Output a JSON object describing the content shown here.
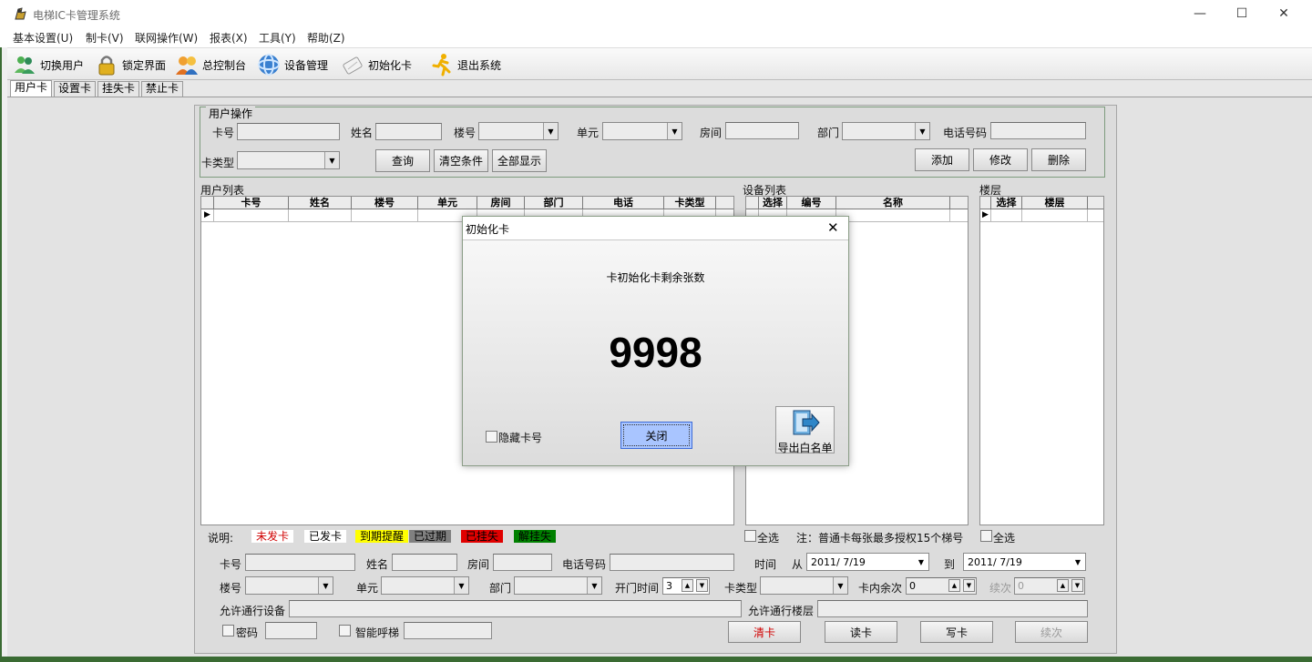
{
  "window": {
    "title": "电梯IC卡管理系统",
    "minimize": "—",
    "maximize": "☐",
    "close": "✕"
  },
  "menu": [
    "基本设置(U)",
    "制卡(V)",
    "联网操作(W)",
    "报表(X)",
    "工具(Y)",
    "帮助(Z)"
  ],
  "toolbar": [
    {
      "label": "切换用户",
      "icon": "users-icon"
    },
    {
      "label": "锁定界面",
      "icon": "lock-icon"
    },
    {
      "label": "总控制台",
      "icon": "console-icon"
    },
    {
      "label": "设备管理",
      "icon": "device-icon"
    },
    {
      "label": "初始化卡",
      "icon": "card-init-icon"
    },
    {
      "label": "退出系统",
      "icon": "exit-runner-icon"
    }
  ],
  "tabs": [
    "用户卡",
    "设置卡",
    "挂失卡",
    "禁止卡"
  ],
  "user_ops": {
    "group_title": "用户操作",
    "card_no": "卡号",
    "name": "姓名",
    "building": "楼号",
    "unit": "单元",
    "room": "房间",
    "dept": "部门",
    "phone": "电话号码",
    "card_type": "卡类型",
    "query": "查询",
    "clear": "清空条件",
    "show_all": "全部显示",
    "add": "添加",
    "modify": "修改",
    "delete": "删除"
  },
  "user_list": {
    "title": "用户列表",
    "columns": [
      "卡号",
      "姓名",
      "楼号",
      "单元",
      "房间",
      "部门",
      "电话",
      "卡类型"
    ]
  },
  "device_list": {
    "title": "设备列表",
    "columns": [
      "选择",
      "编号",
      "名称"
    ]
  },
  "floor_list": {
    "title": "楼层",
    "columns": [
      "选择",
      "楼层"
    ]
  },
  "legend": {
    "label": "说明:",
    "items": [
      {
        "text": "未发卡",
        "bg": "#ffffff",
        "fg": "#d00000"
      },
      {
        "text": "已发卡",
        "bg": "#ffffff",
        "fg": "#000000"
      },
      {
        "text": "到期提醒",
        "bg": "#ffff00",
        "fg": "#000000"
      },
      {
        "text": "已过期",
        "bg": "#808080",
        "fg": "#000000"
      },
      {
        "text": "已挂失",
        "bg": "#e00000",
        "fg": "#000000"
      },
      {
        "text": "解挂失",
        "bg": "#008000",
        "fg": "#000000"
      }
    ]
  },
  "device_select_all": "全选",
  "note": "注：普通卡每张最多授权15个梯号",
  "floor_select_all": "全选",
  "detail": {
    "card_no": "卡号",
    "name": "姓名",
    "room": "房间",
    "phone": "电话号码",
    "time": "时间",
    "from": "从",
    "from_date": "2011/ 7/19",
    "to": "到",
    "to_date": "2011/ 7/19",
    "building": "楼号",
    "unit": "单元",
    "dept": "部门",
    "open_time": "开门时间",
    "open_time_value": "3",
    "card_type": "卡类型",
    "remaining": "卡内余次",
    "remaining_value": "0",
    "renew": "续次",
    "renew_value": "0",
    "allowed_devices": "允许通行设备",
    "allowed_floors": "允许通行楼层",
    "password": "密码",
    "smart_call": "智能呼梯",
    "clear_card": "清卡",
    "read_card": "读卡",
    "write_card": "写卡",
    "renew_btn": "续次"
  },
  "dialog": {
    "title": "初始化卡",
    "close": "✕",
    "message": "卡初始化卡剩余张数",
    "count": "9998",
    "hide_card": "隐藏卡号",
    "close_button": "关闭",
    "export": "导出白名单"
  }
}
